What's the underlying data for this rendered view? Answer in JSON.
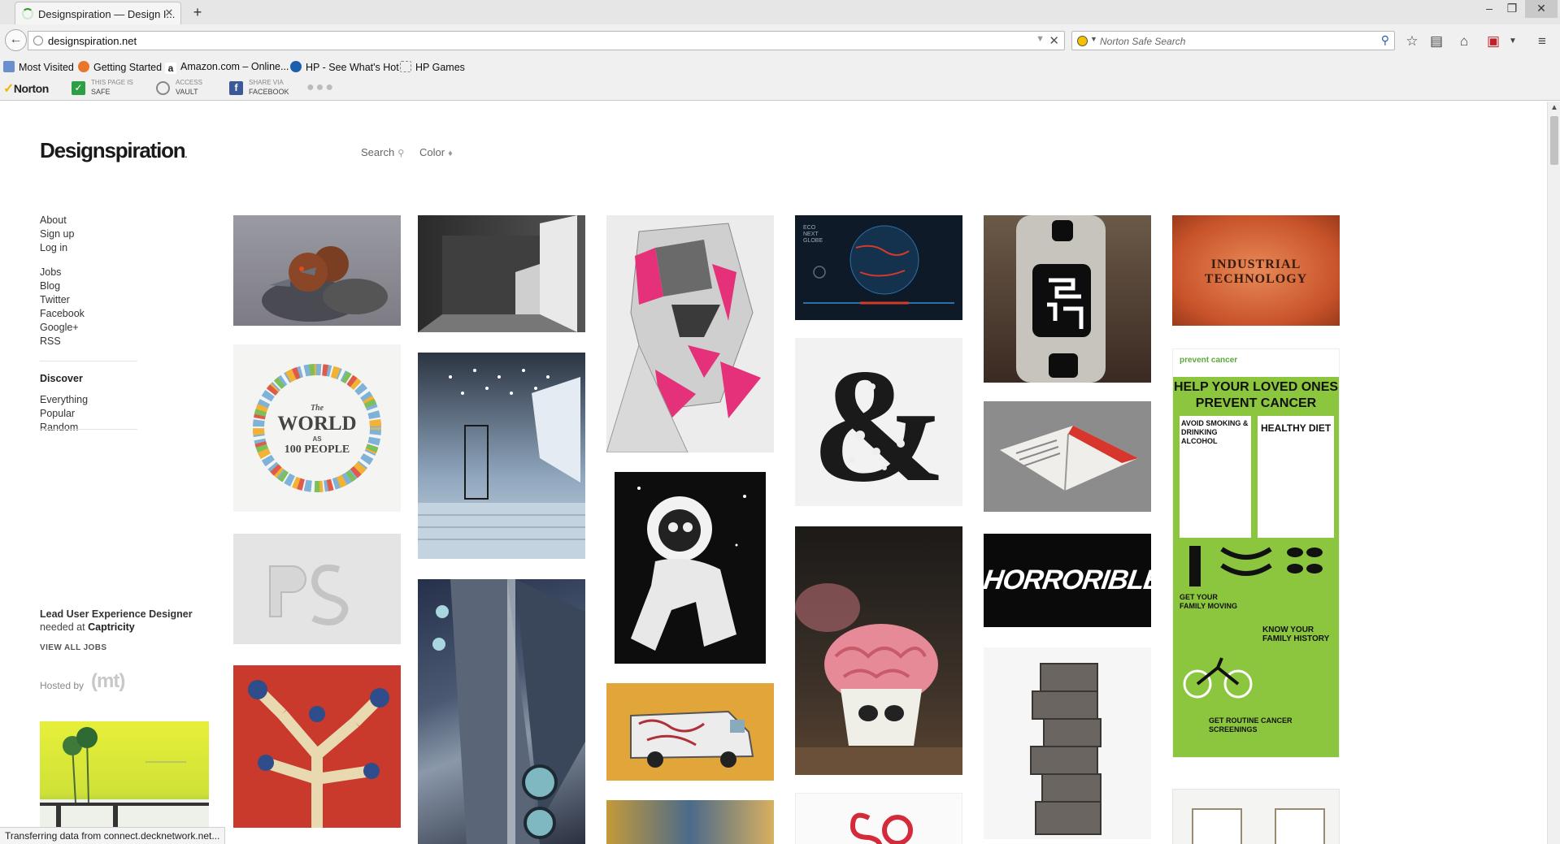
{
  "browser": {
    "tab_title": "Designspiration — Design I...",
    "url": "designspiration.net",
    "search_placeholder": "Norton Safe Search",
    "bookmarks": [
      "Most Visited",
      "Getting Started",
      "Amazon.com – Online...",
      "HP - See What's Hot",
      "HP Games"
    ],
    "norton": {
      "logo": "Norton",
      "safe_line1": "THIS PAGE IS",
      "safe_line2": "SAFE",
      "vault_line1": "ACCESS",
      "vault_line2": "VAULT",
      "share_line1": "SHARE VIA",
      "share_line2": "FACEBOOK"
    },
    "status": "Transferring data from connect.decknetwork.net..."
  },
  "site": {
    "logo": "Designspiration",
    "topnav": {
      "search": "Search",
      "color": "Color"
    },
    "sidebar": {
      "group1": [
        "About",
        "Sign up",
        "Log in"
      ],
      "group2": [
        "Jobs",
        "Blog",
        "Twitter",
        "Facebook",
        "Google+",
        "RSS"
      ],
      "discover_heading": "Discover",
      "discover": [
        "Everything",
        "Popular",
        "Random"
      ]
    },
    "job": {
      "title": "Lead User Experience Designer",
      "needed_at": "needed at",
      "company": "Captricity",
      "view_all": "VIEW ALL JOBS"
    },
    "hosted_by": "Hosted by",
    "hosted_logo": "(mt)"
  },
  "grid": {
    "industrial_line1": "INDUSTRIAL",
    "industrial_line2": "TECHNOLOGY",
    "world_line1": "The",
    "world_line2": "WORLD",
    "world_line3": "AS",
    "world_line4": "100 PEOPLE",
    "horrorible": "HORRORIBLE",
    "cancer_top": "prevent cancer",
    "cancer_headline1": "HELP YOUR LOVED ONES",
    "cancer_headline2": "PREVENT CANCER",
    "cancer_s1": "AVOID SMOKING & DRINKING ALCOHOL",
    "cancer_s2": "HEALTHY DIET",
    "cancer_s3": "GET YOUR FAMILY MOVING",
    "cancer_s4": "KNOW YOUR FAMILY HISTORY",
    "cancer_s5": "GET ROUTINE CANCER SCREENINGS",
    "eco_label": "ECO NEXT GLOBE"
  }
}
